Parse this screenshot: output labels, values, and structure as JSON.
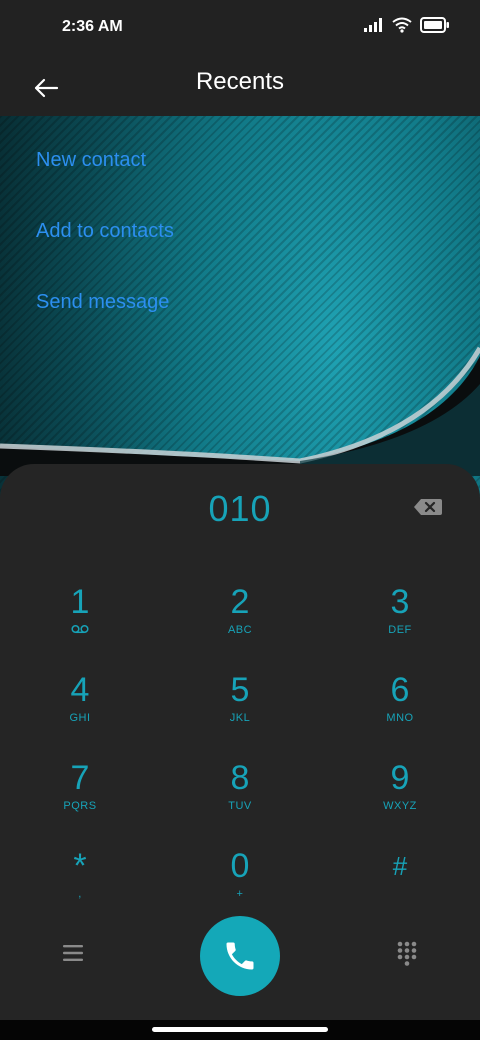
{
  "status_bar": {
    "time": "2:36 AM",
    "icons": [
      "signal-icon",
      "wifi-icon",
      "battery-icon"
    ]
  },
  "app_bar": {
    "title": "Recents",
    "back_icon": "arrow-left-icon"
  },
  "actions": [
    {
      "label": "New contact"
    },
    {
      "label": "Add to contacts"
    },
    {
      "label": "Send message"
    }
  ],
  "dialpad": {
    "entered_number": "010",
    "backspace_icon": "backspace-icon",
    "keys": [
      {
        "num": "1",
        "sub": "",
        "sub_icon": "voicemail-icon"
      },
      {
        "num": "2",
        "sub": "ABC"
      },
      {
        "num": "3",
        "sub": "DEF"
      },
      {
        "num": "4",
        "sub": "GHI"
      },
      {
        "num": "5",
        "sub": "JKL"
      },
      {
        "num": "6",
        "sub": "MNO"
      },
      {
        "num": "7",
        "sub": "PQRS"
      },
      {
        "num": "8",
        "sub": "TUV"
      },
      {
        "num": "9",
        "sub": "WXYZ"
      },
      {
        "num": "*",
        "sub": ","
      },
      {
        "num": "0",
        "sub": "+"
      },
      {
        "num": "#",
        "sub": ""
      }
    ]
  },
  "bottom_bar": {
    "menu_icon": "menu-icon",
    "call_icon": "phone-icon",
    "keypad_icon": "dialpad-icon"
  },
  "colors": {
    "accent": "#17a3b8",
    "link": "#2c8ff0",
    "call_button": "#14a8b8",
    "panel": "#252525"
  }
}
